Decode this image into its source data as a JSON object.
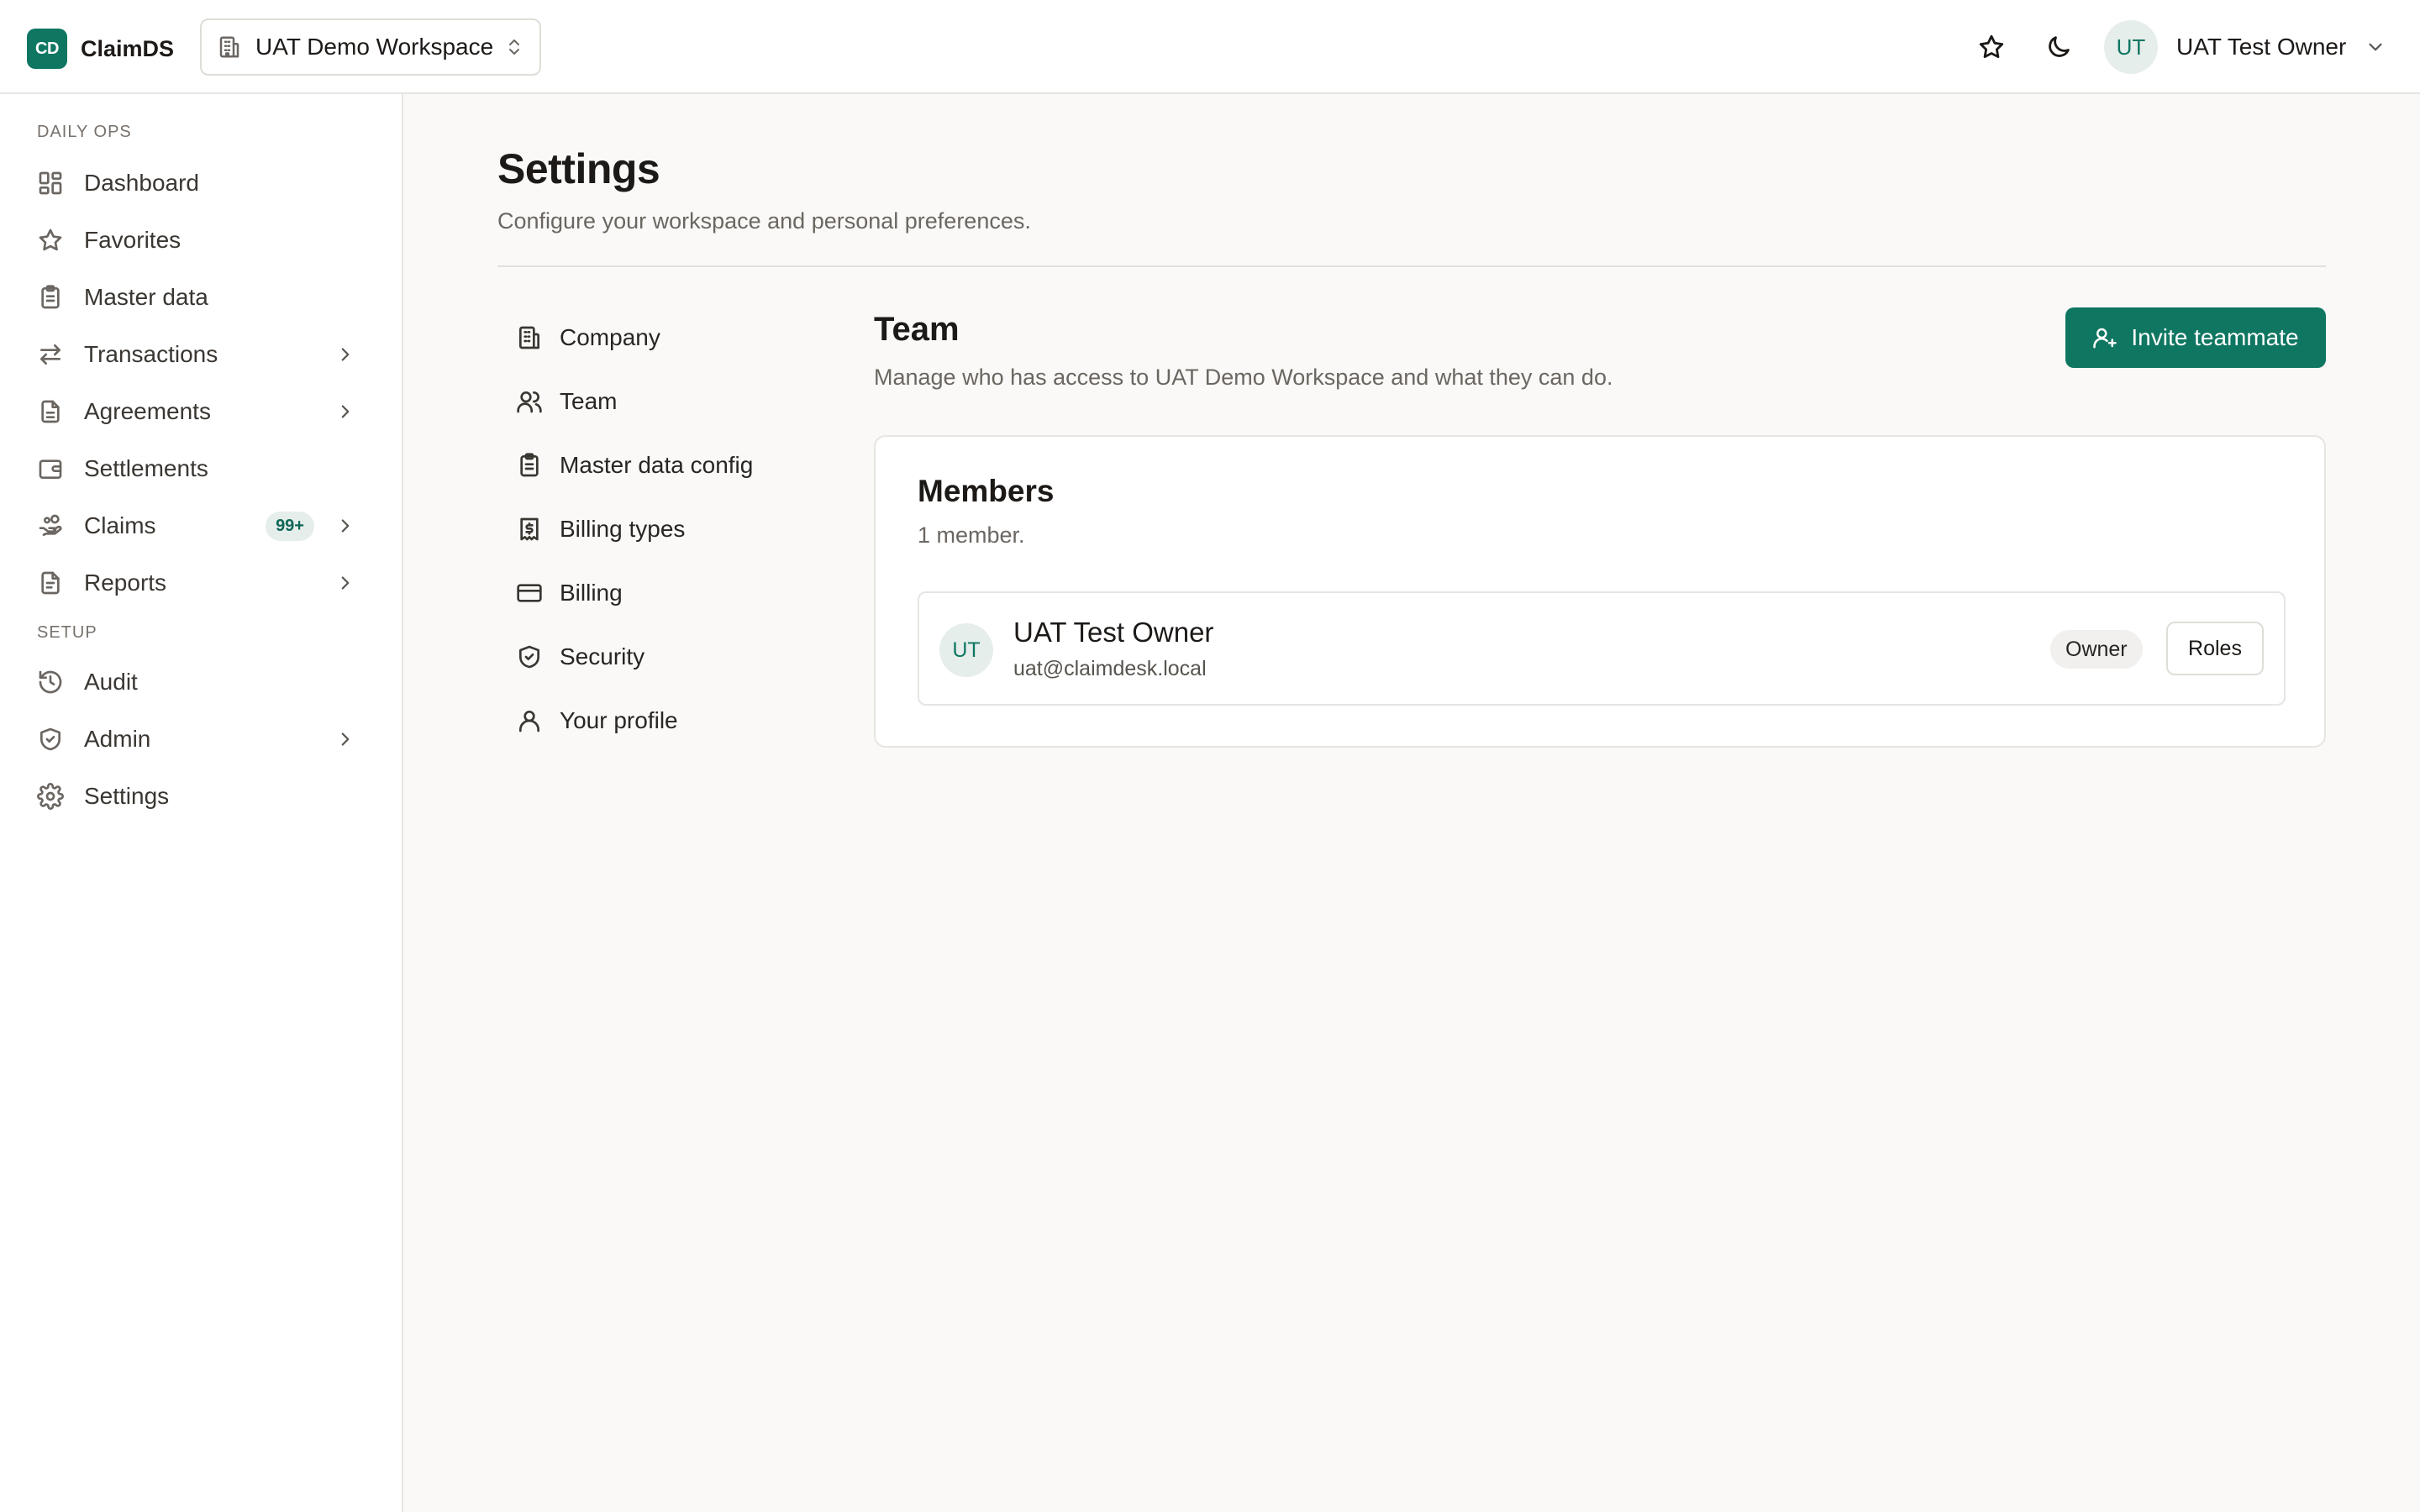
{
  "app": {
    "logo_text": "CD",
    "name": "ClaimDS"
  },
  "header": {
    "workspace_label": "UAT Demo Workspace",
    "user": {
      "initials": "UT",
      "name": "UAT Test Owner"
    }
  },
  "sidebar": {
    "sections": [
      {
        "label": "Daily ops",
        "items": [
          {
            "label": "Dashboard",
            "icon": "dashboard-icon"
          },
          {
            "label": "Favorites",
            "icon": "star-icon"
          },
          {
            "label": "Master data",
            "icon": "clipboard-icon"
          },
          {
            "label": "Transactions",
            "icon": "arrows-left-right-icon",
            "has_submenu": true
          },
          {
            "label": "Agreements",
            "icon": "document-icon",
            "has_submenu": true
          },
          {
            "label": "Settlements",
            "icon": "wallet-icon"
          },
          {
            "label": "Claims",
            "icon": "hand-coins-icon",
            "badge": "99+",
            "has_submenu": true
          },
          {
            "label": "Reports",
            "icon": "report-icon",
            "has_submenu": true
          }
        ]
      },
      {
        "label": "Setup",
        "items": [
          {
            "label": "Audit",
            "icon": "history-icon"
          },
          {
            "label": "Admin",
            "icon": "shield-icon",
            "has_submenu": true
          },
          {
            "label": "Settings",
            "icon": "gear-icon"
          }
        ]
      }
    ]
  },
  "page": {
    "title": "Settings",
    "subtitle": "Configure your workspace and personal preferences."
  },
  "settings_nav": [
    {
      "label": "Company",
      "icon": "building-icon"
    },
    {
      "label": "Team",
      "icon": "users-icon"
    },
    {
      "label": "Master data config",
      "icon": "clipboard-icon"
    },
    {
      "label": "Billing types",
      "icon": "receipt-icon"
    },
    {
      "label": "Billing",
      "icon": "credit-card-icon"
    },
    {
      "label": "Security",
      "icon": "shield-check-icon"
    },
    {
      "label": "Your profile",
      "icon": "user-icon"
    }
  ],
  "team": {
    "title": "Team",
    "description": "Manage who has access to UAT Demo Workspace and what they can do.",
    "invite_label": "Invite teammate",
    "members_card": {
      "title": "Members",
      "count_text": "1 member.",
      "members": [
        {
          "initials": "UT",
          "name": "UAT Test Owner",
          "email": "uat@claimdesk.local",
          "role": "Owner",
          "roles_button": "Roles"
        }
      ]
    }
  },
  "colors": {
    "accent": "#0f7661",
    "background": "#faf9f7",
    "surface": "#ffffff",
    "border": "#e7e5e2"
  }
}
